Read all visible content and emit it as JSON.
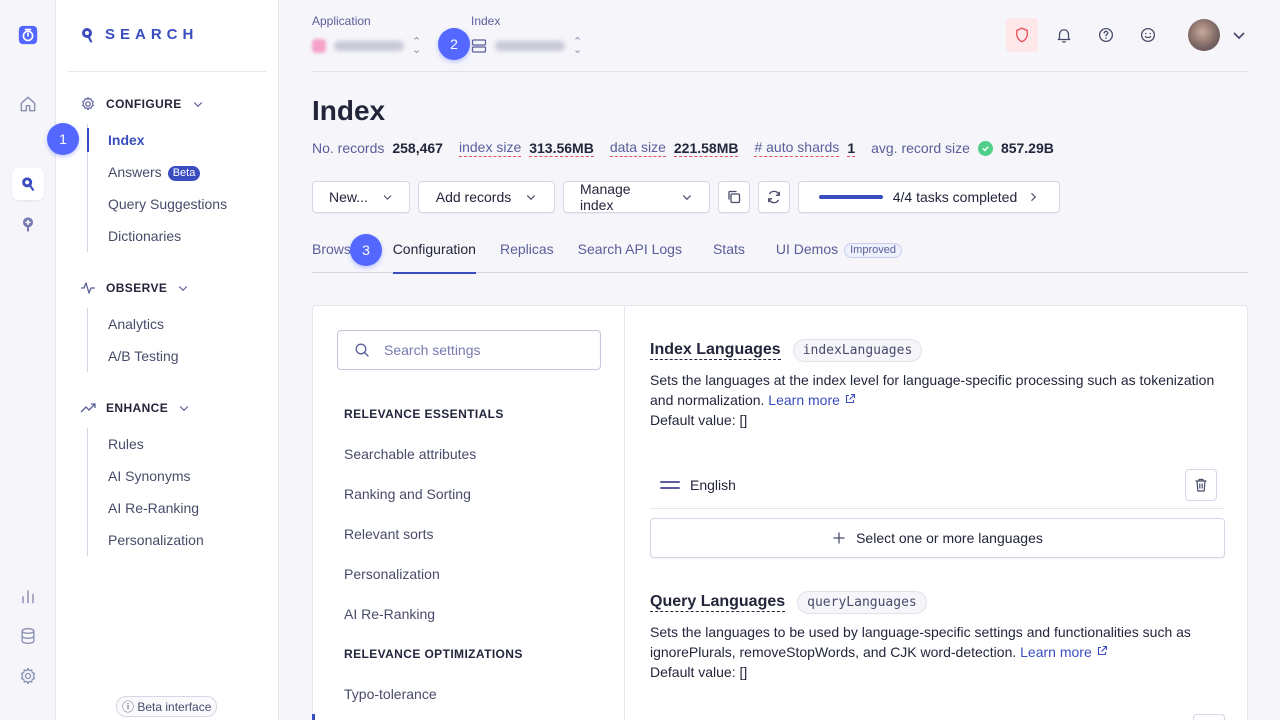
{
  "brand": {
    "name": "SEARCH"
  },
  "rail": {
    "icons": [
      "product-logo-icon",
      "home-icon",
      "search-product-icon",
      "recommend-icon",
      "analytics-bars-icon",
      "data-sources-icon",
      "settings-icon"
    ]
  },
  "sidebar": {
    "configure": {
      "title": "CONFIGURE",
      "items": [
        {
          "label": "Index"
        },
        {
          "label": "Answers",
          "badge": "Beta"
        },
        {
          "label": "Query Suggestions"
        },
        {
          "label": "Dictionaries"
        }
      ]
    },
    "observe": {
      "title": "OBSERVE",
      "items": [
        {
          "label": "Analytics"
        },
        {
          "label": "A/B Testing"
        }
      ]
    },
    "enhance": {
      "title": "ENHANCE",
      "items": [
        {
          "label": "Rules"
        },
        {
          "label": "AI Synonyms"
        },
        {
          "label": "AI Re-Ranking"
        },
        {
          "label": "Personalization"
        }
      ]
    },
    "beta_interface": "Beta interface"
  },
  "topbar": {
    "application_label": "Application",
    "index_label": "Index"
  },
  "steps": [
    "1",
    "2",
    "3"
  ],
  "page": {
    "title": "Index",
    "stats": [
      {
        "label": "No. records",
        "value": "258,467"
      },
      {
        "label": "index size",
        "value": "313.56MB"
      },
      {
        "label": "data size",
        "value": "221.58MB"
      },
      {
        "label": "# auto shards",
        "value": "1"
      },
      {
        "label": "avg. record size",
        "value": "857.29B"
      }
    ]
  },
  "actions": {
    "new_label": "New...",
    "add_records_label": "Add records",
    "manage_index_label": "Manage index",
    "tasks_label": "4/4 tasks completed",
    "tasks_progress": 1.0
  },
  "tabs": [
    {
      "label": "Browse"
    },
    {
      "label": "Configuration"
    },
    {
      "label": "Replicas"
    },
    {
      "label": "Search API Logs"
    },
    {
      "label": "Stats"
    },
    {
      "label": "UI Demos",
      "badge": "Improved"
    }
  ],
  "settings": {
    "search_placeholder": "Search settings",
    "groups": [
      {
        "title": "RELEVANCE ESSENTIALS",
        "items": [
          "Searchable attributes",
          "Ranking and Sorting",
          "Relevant sorts",
          "Personalization",
          "AI Re-Ranking"
        ]
      },
      {
        "title": "RELEVANCE OPTIMIZATIONS",
        "items": [
          "Typo-tolerance"
        ]
      }
    ]
  },
  "index_languages": {
    "title": "Index Languages",
    "code": "indexLanguages",
    "desc": "Sets the languages at the index level for language-specific processing such as tokenization and normalization.",
    "learn_more": "Learn more",
    "default": "Default value: []",
    "language": "English",
    "add_label": "Select one or more languages"
  },
  "query_languages": {
    "title": "Query Languages",
    "code": "queryLanguages",
    "desc": "Sets the languages to be used by language-specific settings and functionalities such as ignorePlurals, removeStopWords, and CJK word-detection.",
    "learn_more": "Learn more",
    "default": "Default value: []"
  },
  "colors": {
    "accent": "#3a4dbf",
    "step": "#5468ff",
    "success": "#4fcf8a",
    "danger": "#e8505b"
  }
}
